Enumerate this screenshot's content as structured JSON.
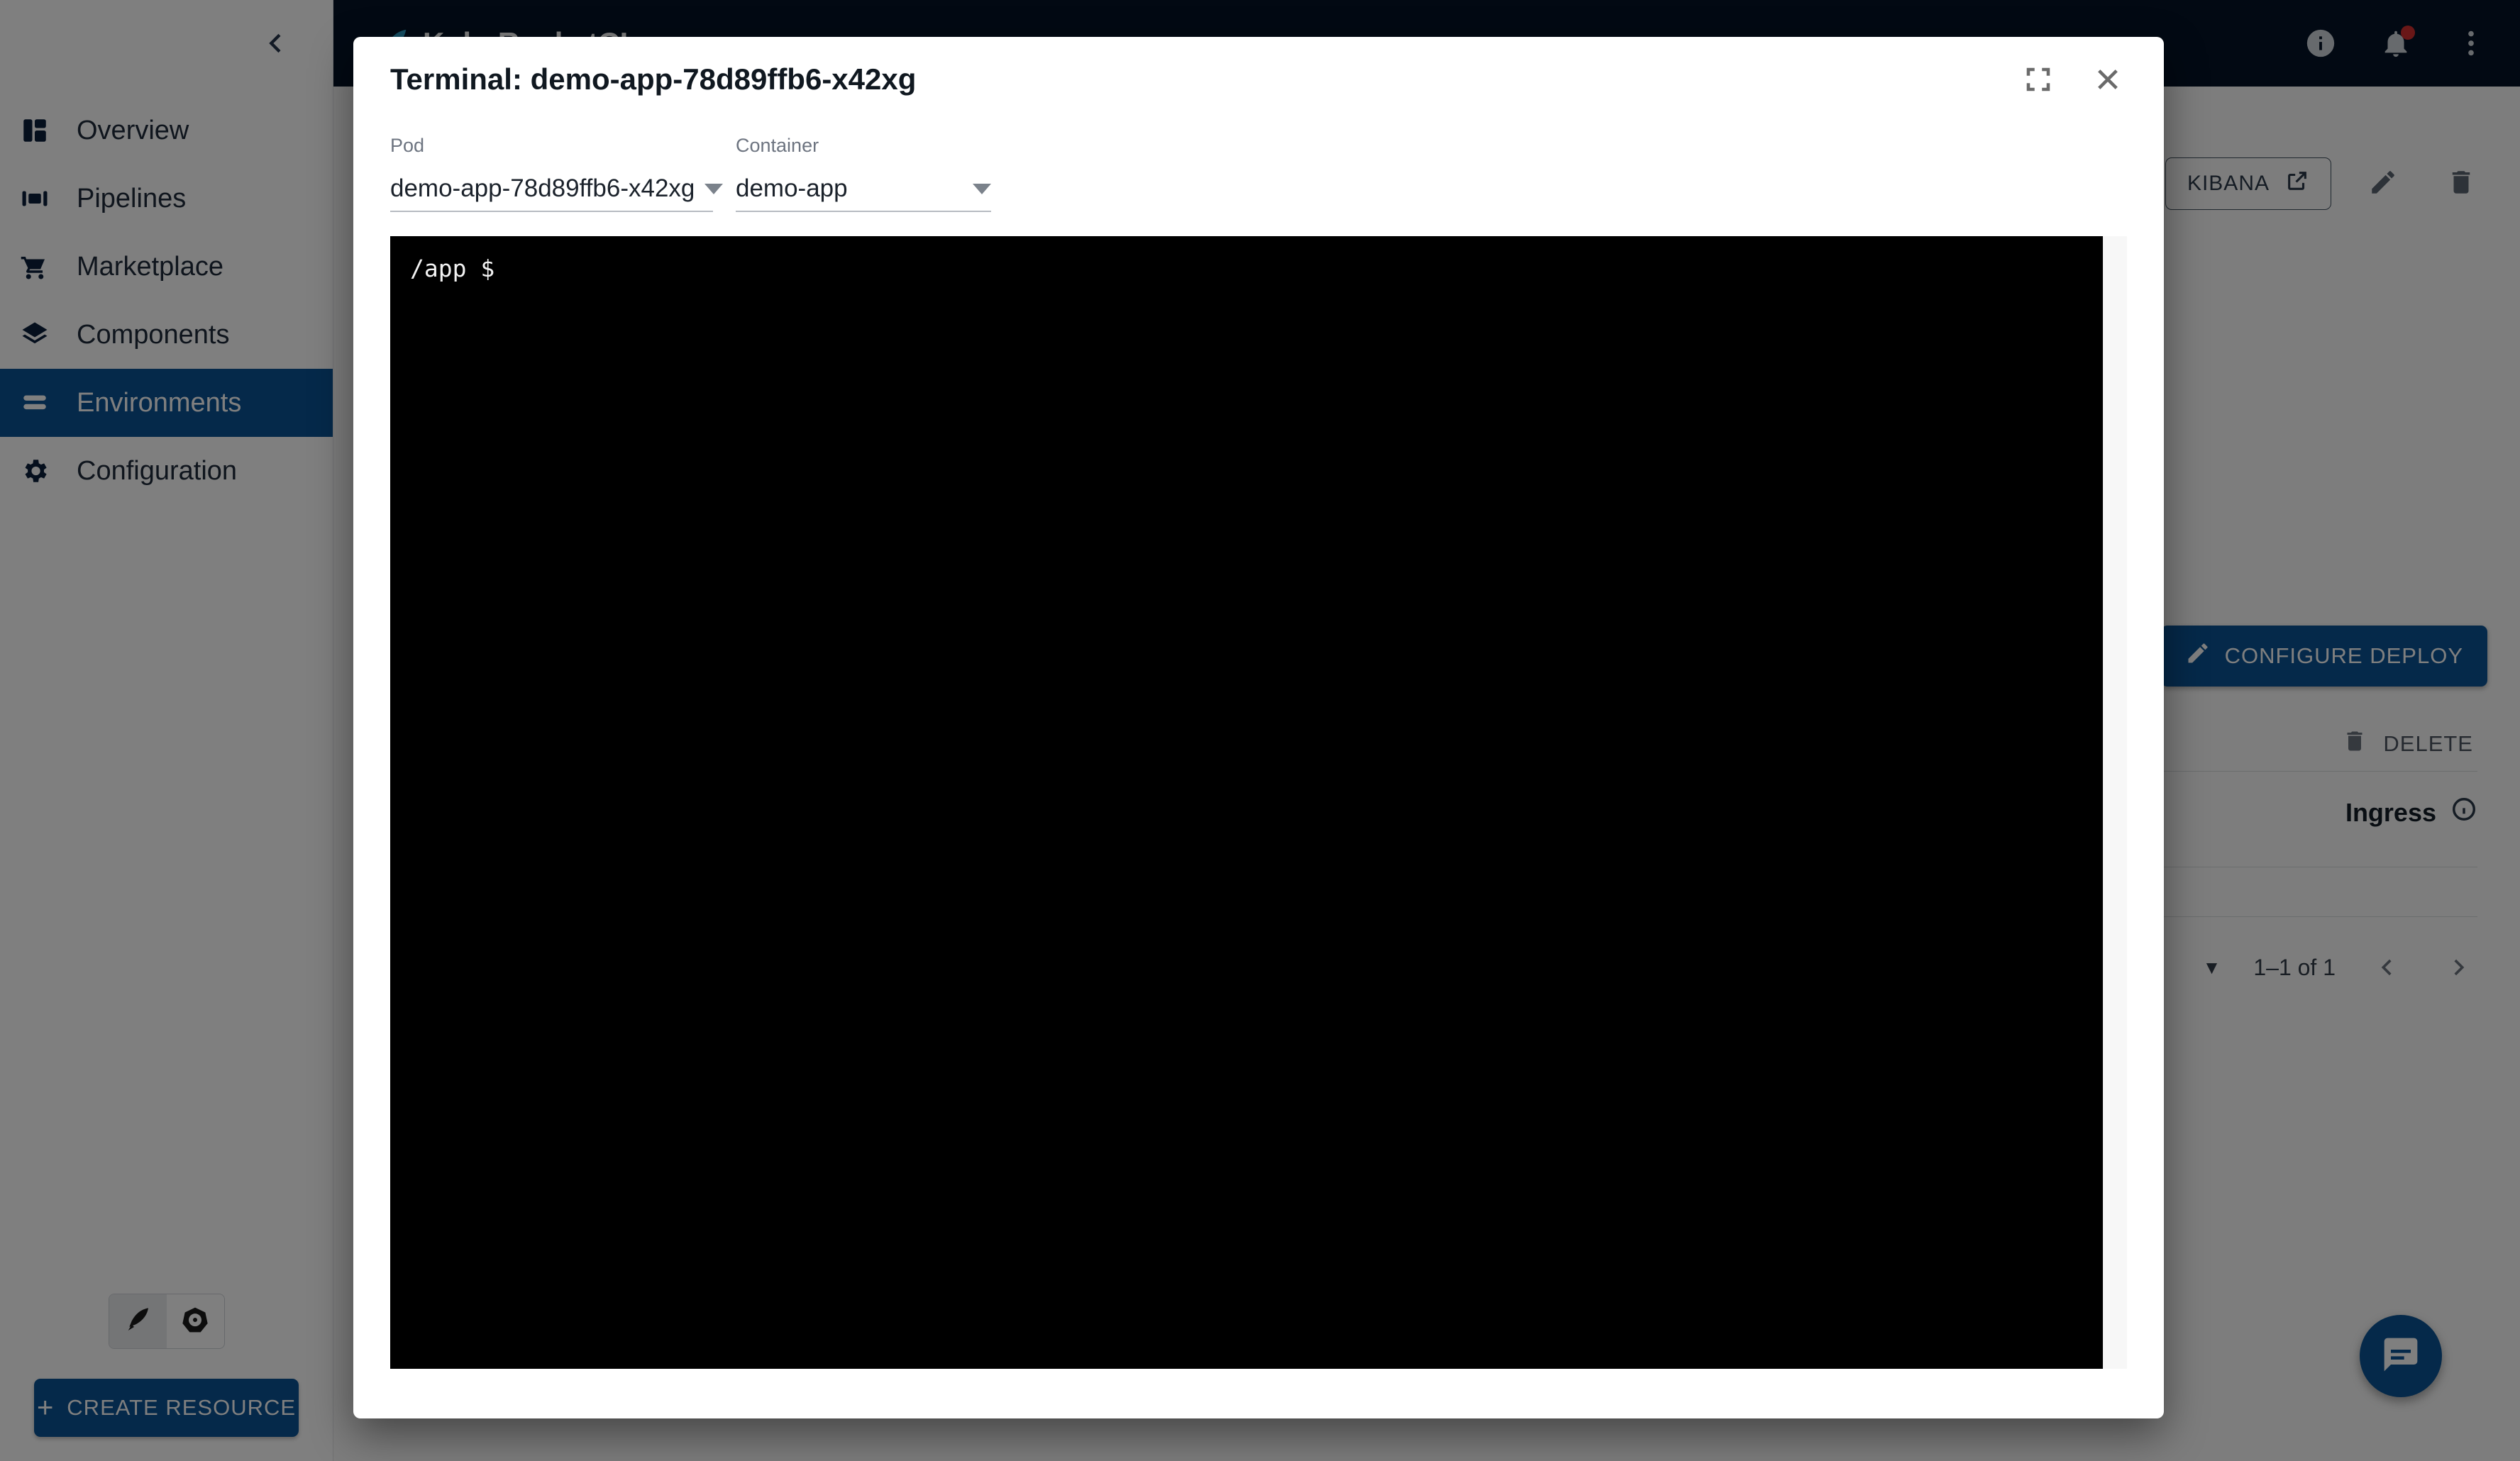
{
  "header": {
    "brand": "KubeRocketCI",
    "logo_icon": "rocket-feather-icon",
    "info_icon": "info-circle-icon",
    "notifications_icon": "bell-icon",
    "menu_icon": "more-vertical-icon",
    "background_color": "#041326"
  },
  "sidebar": {
    "collapse_icon": "chevron-left-icon",
    "accent_color": "#0b5394",
    "items": [
      {
        "label": "Overview",
        "icon": "dashboard-icon",
        "active": false
      },
      {
        "label": "Pipelines",
        "icon": "pipelines-icon",
        "active": false
      },
      {
        "label": "Marketplace",
        "icon": "cart-icon",
        "active": false
      },
      {
        "label": "Components",
        "icon": "layers-icon",
        "active": false
      },
      {
        "label": "Environments",
        "icon": "environments-icon",
        "active": true
      },
      {
        "label": "Configuration",
        "icon": "gear-icon",
        "active": false
      }
    ],
    "mode_toggle": [
      {
        "icon": "rocket-feather-icon",
        "selected": true
      },
      {
        "icon": "kubernetes-helm-icon",
        "selected": false
      }
    ],
    "create_button": {
      "label": "CREATE RESOURCE",
      "icon": "plus-icon"
    }
  },
  "main": {
    "top_actions": {
      "external_link_button_icon": "external-link-icon",
      "kibana_label": "KIBANA",
      "kibana_icon": "external-link-icon",
      "edit_icon": "pencil-icon",
      "delete_icon": "trash-icon"
    },
    "configure_deploy": {
      "label": "CONFIGURE DEPLOY",
      "icon": "pencil-icon"
    },
    "delete": {
      "label": "DELETE",
      "icon": "trash-icon"
    },
    "ingress": {
      "label": "Ingress",
      "icon": "info-circle-icon"
    },
    "pagination": {
      "rows_caret": "▼",
      "range_label": "1–1 of 1",
      "prev_icon": "chevron-left-icon",
      "next_icon": "chevron-right-icon"
    },
    "fab_icon": "chat-feedback-icon"
  },
  "dialog": {
    "title": "Terminal: demo-app-78d89ffb6-x42xg",
    "fullscreen_icon": "fullscreen-icon",
    "close_icon": "close-icon",
    "pod": {
      "label": "Pod",
      "value": "demo-app-78d89ffb6-x42xg"
    },
    "container": {
      "label": "Container",
      "value": "demo-app"
    },
    "terminal": {
      "background_color": "#000000",
      "text_color": "#f2f2f2",
      "lines": [
        "/app $"
      ]
    }
  }
}
